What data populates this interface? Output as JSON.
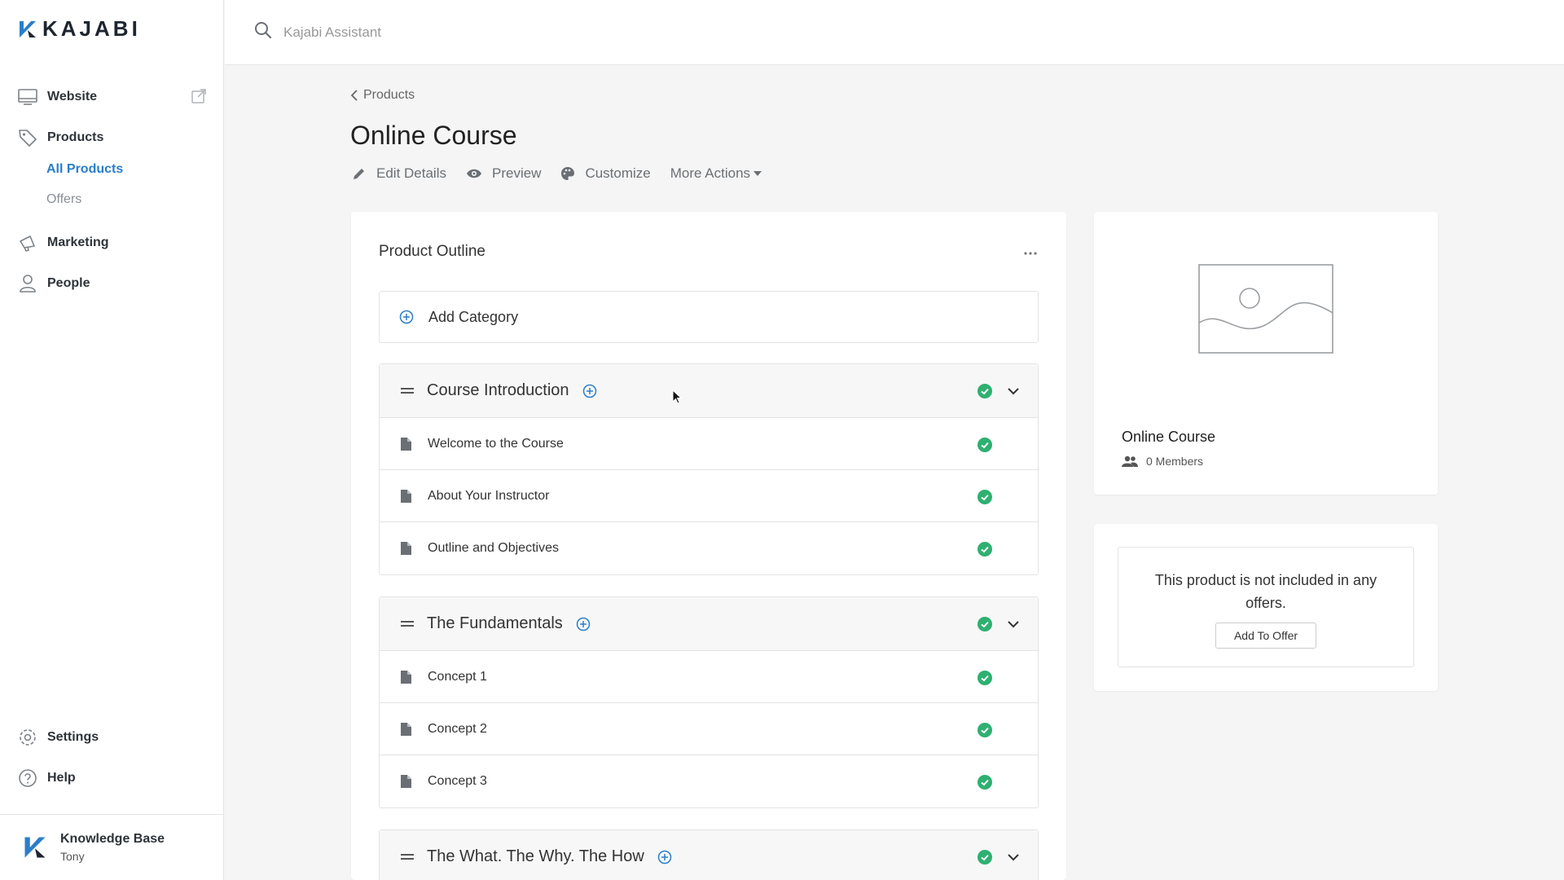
{
  "brand": {
    "name": "KAJABI",
    "accent": "#2a7ec9",
    "check_color": "#2eb070"
  },
  "sidebar": {
    "items": [
      {
        "label": "Website",
        "icon": "monitor-icon"
      },
      {
        "label": "Products",
        "icon": "tag-icon"
      },
      {
        "label": "Marketing",
        "icon": "megaphone-icon"
      },
      {
        "label": "People",
        "icon": "person-icon"
      },
      {
        "label": "Settings",
        "icon": "gear-icon"
      },
      {
        "label": "Help",
        "icon": "help-icon"
      }
    ],
    "products_sub": [
      {
        "label": "All Products",
        "active": true
      },
      {
        "label": "Offers",
        "active": false
      }
    ],
    "footer": {
      "title": "Knowledge Base",
      "user": "Tony"
    }
  },
  "search": {
    "placeholder": "Kajabi Assistant"
  },
  "breadcrumb": {
    "label": "Products"
  },
  "page": {
    "title": "Online Course"
  },
  "actions": {
    "edit": "Edit Details",
    "preview": "Preview",
    "customize": "Customize",
    "more": "More Actions"
  },
  "outline": {
    "title": "Product Outline",
    "add_category": "Add Category",
    "categories": [
      {
        "title": "Course Introduction",
        "lessons": [
          "Welcome to the Course",
          "About Your Instructor",
          "Outline and Objectives"
        ]
      },
      {
        "title": "The Fundamentals",
        "lessons": [
          "Concept 1",
          "Concept 2",
          "Concept 3"
        ]
      },
      {
        "title": "The What. The Why. The How",
        "lessons": []
      }
    ]
  },
  "product_card": {
    "title": "Online Course",
    "members": "0 Members"
  },
  "offer_card": {
    "text": "This product is not included in any offers.",
    "button": "Add To Offer"
  }
}
